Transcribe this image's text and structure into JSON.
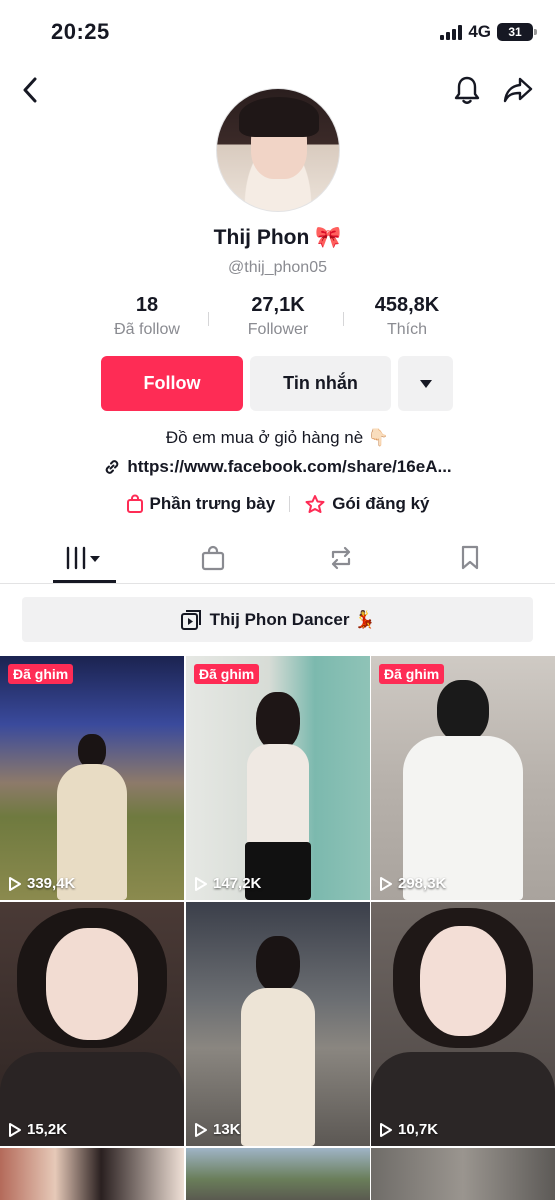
{
  "status_bar": {
    "time": "20:25",
    "network": "4G",
    "battery": "31"
  },
  "profile": {
    "name": "Thij Phon 🎀",
    "handle": "@thij_phon05",
    "bio": "Đồ em mua ở giỏ hàng  nè 👇🏻",
    "link": "https://www.facebook.com/share/16eA..."
  },
  "stats": [
    {
      "value": "18",
      "label": "Đã follow"
    },
    {
      "value": "27,1K",
      "label": "Follower"
    },
    {
      "value": "458,8K",
      "label": "Thích"
    }
  ],
  "actions": {
    "follow": "Follow",
    "message": "Tin nhắn"
  },
  "extras": {
    "showcase": "Phần trưng bày",
    "subscription": "Gói đăng ký"
  },
  "playlist": {
    "label": "Thij Phon Dancer 💃"
  },
  "videos": [
    {
      "pinned_label": "Đã ghim",
      "views": "339,4K",
      "pinned": true
    },
    {
      "pinned_label": "Đã ghim",
      "views": "147,2K",
      "pinned": true
    },
    {
      "pinned_label": "Đã ghim",
      "views": "298,3K",
      "pinned": true
    },
    {
      "views": "15,2K",
      "pinned": false
    },
    {
      "views": "13K",
      "pinned": false
    },
    {
      "views": "10,7K",
      "pinned": false
    }
  ],
  "colors": {
    "accent": "#fe2c55",
    "text": "#161823",
    "muted": "#8a8b91",
    "button_bg": "#f1f1f2"
  },
  "icons": {
    "back": "back-arrow-icon",
    "bell": "bell-icon",
    "share": "share-icon",
    "more": "caret-down-icon",
    "link": "link-icon",
    "shop": "shopping-bag-icon",
    "subscription": "star-badge-icon",
    "tab_videos": "grid-icon",
    "tab_shop": "shopping-bag-icon",
    "tab_repost": "repost-icon",
    "tab_saved": "bookmark-icon",
    "playlist": "playlist-icon",
    "play": "play-icon"
  }
}
